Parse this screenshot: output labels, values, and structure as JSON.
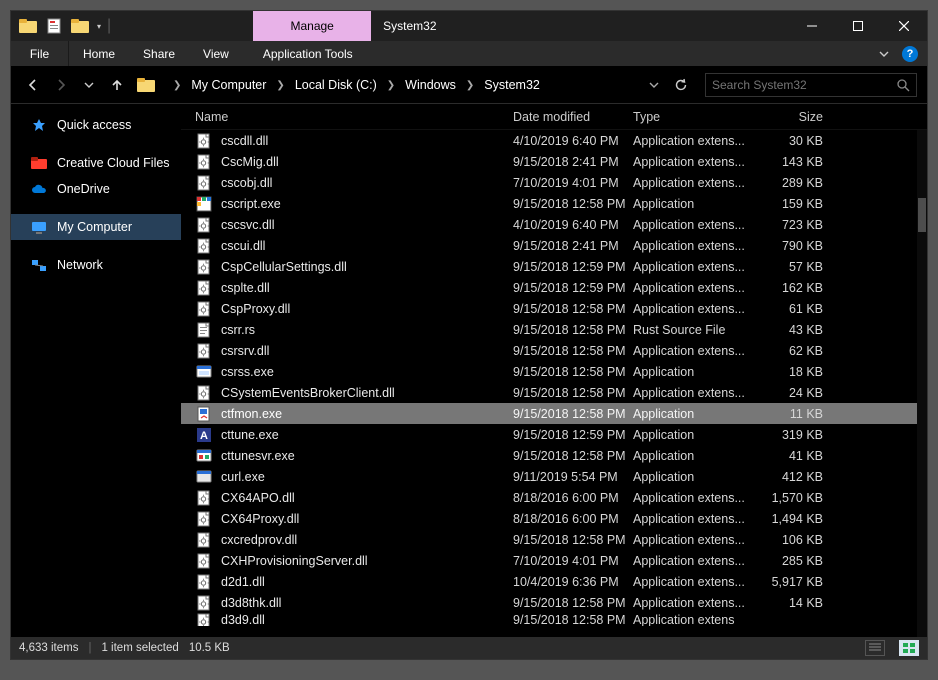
{
  "window": {
    "title": "System32",
    "manage_tab": "Manage"
  },
  "ribbon": {
    "file": "File",
    "tabs": [
      "Home",
      "Share",
      "View"
    ],
    "context_tab": "Application Tools"
  },
  "breadcrumb": {
    "items": [
      "My Computer",
      "Local Disk (C:)",
      "Windows",
      "System32"
    ]
  },
  "search": {
    "placeholder": "Search System32"
  },
  "sidebar": {
    "items": [
      {
        "label": "Quick access",
        "icon": "star",
        "color": "#3aa0ff"
      },
      {
        "label": "Creative Cloud Files",
        "icon": "cc",
        "color": "#ff3d2e"
      },
      {
        "label": "OneDrive",
        "icon": "cloud",
        "color": "#0078d7"
      },
      {
        "label": "My Computer",
        "icon": "monitor",
        "color": "#3aa0ff",
        "selected": true
      },
      {
        "label": "Network",
        "icon": "network",
        "color": "#3aa0ff"
      }
    ]
  },
  "columns": {
    "name": "Name",
    "date": "Date modified",
    "type": "Type",
    "size": "Size"
  },
  "files": [
    {
      "icon": "dll",
      "name": "cscdll.dll",
      "date": "4/10/2019 6:40 PM",
      "type": "Application extens...",
      "size": "30 KB"
    },
    {
      "icon": "dll",
      "name": "CscMig.dll",
      "date": "9/15/2018 2:41 PM",
      "type": "Application extens...",
      "size": "143 KB"
    },
    {
      "icon": "dll",
      "name": "cscobj.dll",
      "date": "7/10/2019 4:01 PM",
      "type": "Application extens...",
      "size": "289 KB"
    },
    {
      "icon": "cscript",
      "name": "cscript.exe",
      "date": "9/15/2018 12:58 PM",
      "type": "Application",
      "size": "159 KB"
    },
    {
      "icon": "dll",
      "name": "cscsvc.dll",
      "date": "4/10/2019 6:40 PM",
      "type": "Application extens...",
      "size": "723 KB"
    },
    {
      "icon": "dll",
      "name": "cscui.dll",
      "date": "9/15/2018 2:41 PM",
      "type": "Application extens...",
      "size": "790 KB"
    },
    {
      "icon": "dll",
      "name": "CspCellularSettings.dll",
      "date": "9/15/2018 12:59 PM",
      "type": "Application extens...",
      "size": "57 KB"
    },
    {
      "icon": "dll",
      "name": "csplte.dll",
      "date": "9/15/2018 12:59 PM",
      "type": "Application extens...",
      "size": "162 KB"
    },
    {
      "icon": "dll",
      "name": "CspProxy.dll",
      "date": "9/15/2018 12:58 PM",
      "type": "Application extens...",
      "size": "61 KB"
    },
    {
      "icon": "rs",
      "name": "csrr.rs",
      "date": "9/15/2018 12:58 PM",
      "type": "Rust Source File",
      "size": "43 KB"
    },
    {
      "icon": "dll",
      "name": "csrsrv.dll",
      "date": "9/15/2018 12:58 PM",
      "type": "Application extens...",
      "size": "62 KB"
    },
    {
      "icon": "csrss",
      "name": "csrss.exe",
      "date": "9/15/2018 12:58 PM",
      "type": "Application",
      "size": "18 KB"
    },
    {
      "icon": "dll",
      "name": "CSystemEventsBrokerClient.dll",
      "date": "9/15/2018 12:58 PM",
      "type": "Application extens...",
      "size": "24 KB"
    },
    {
      "icon": "ctfmon",
      "name": "ctfmon.exe",
      "date": "9/15/2018 12:58 PM",
      "type": "Application",
      "size": "11 KB",
      "selected": true
    },
    {
      "icon": "cttune",
      "name": "cttune.exe",
      "date": "9/15/2018 12:59 PM",
      "type": "Application",
      "size": "319 KB"
    },
    {
      "icon": "cttunesvr",
      "name": "cttunesvr.exe",
      "date": "9/15/2018 12:58 PM",
      "type": "Application",
      "size": "41 KB"
    },
    {
      "icon": "exe",
      "name": "curl.exe",
      "date": "9/11/2019 5:54 PM",
      "type": "Application",
      "size": "412 KB"
    },
    {
      "icon": "dll",
      "name": "CX64APO.dll",
      "date": "8/18/2016 6:00 PM",
      "type": "Application extens...",
      "size": "1,570 KB"
    },
    {
      "icon": "dll",
      "name": "CX64Proxy.dll",
      "date": "8/18/2016 6:00 PM",
      "type": "Application extens...",
      "size": "1,494 KB"
    },
    {
      "icon": "dll",
      "name": "cxcredprov.dll",
      "date": "9/15/2018 12:58 PM",
      "type": "Application extens...",
      "size": "106 KB"
    },
    {
      "icon": "dll",
      "name": "CXHProvisioningServer.dll",
      "date": "7/10/2019 4:01 PM",
      "type": "Application extens...",
      "size": "285 KB"
    },
    {
      "icon": "dll",
      "name": "d2d1.dll",
      "date": "10/4/2019 6:36 PM",
      "type": "Application extens...",
      "size": "5,917 KB"
    },
    {
      "icon": "dll",
      "name": "d3d8thk.dll",
      "date": "9/15/2018 12:58 PM",
      "type": "Application extens...",
      "size": "14 KB"
    },
    {
      "icon": "dll",
      "name": "d3d9.dll",
      "date": "9/15/2018 12:58 PM",
      "type": "Application extens",
      "size": "",
      "cutoff": true
    }
  ],
  "status": {
    "count": "4,633 items",
    "selection": "1 item selected",
    "sel_size": "10.5 KB"
  }
}
